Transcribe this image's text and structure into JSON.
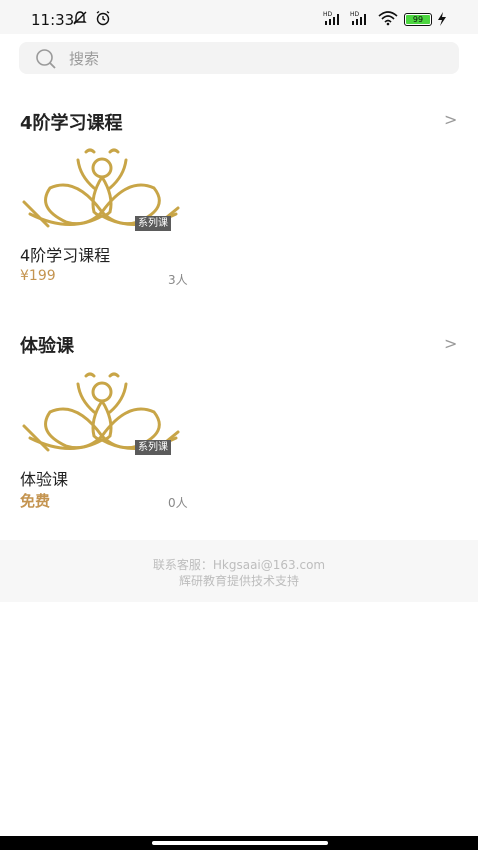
{
  "status_bar": {
    "time": "11:33",
    "icons": [
      "silent-bell-icon",
      "alarm-icon",
      "hd-signal-icon",
      "hd-signal-icon",
      "wifi-icon",
      "battery-icon",
      "charging-icon"
    ],
    "battery": "99"
  },
  "search": {
    "placeholder": "搜索"
  },
  "sections": [
    {
      "title": "4阶学习课程",
      "chevron": ">",
      "course": {
        "badge": "系列课",
        "title": "4阶学习课程",
        "price": "¥199",
        "count": "3人"
      }
    },
    {
      "title": "体验课",
      "chevron": ">",
      "course": {
        "badge": "系列课",
        "title": "体验课",
        "price": "免费",
        "count": "0人"
      }
    }
  ],
  "footer": {
    "contact": "联系客服：Hkgsaai@163.com",
    "powered": "辉研教育提供技术支持"
  },
  "colors": {
    "accent_gold": "#c49450",
    "logo_gold": "#c8a547"
  }
}
